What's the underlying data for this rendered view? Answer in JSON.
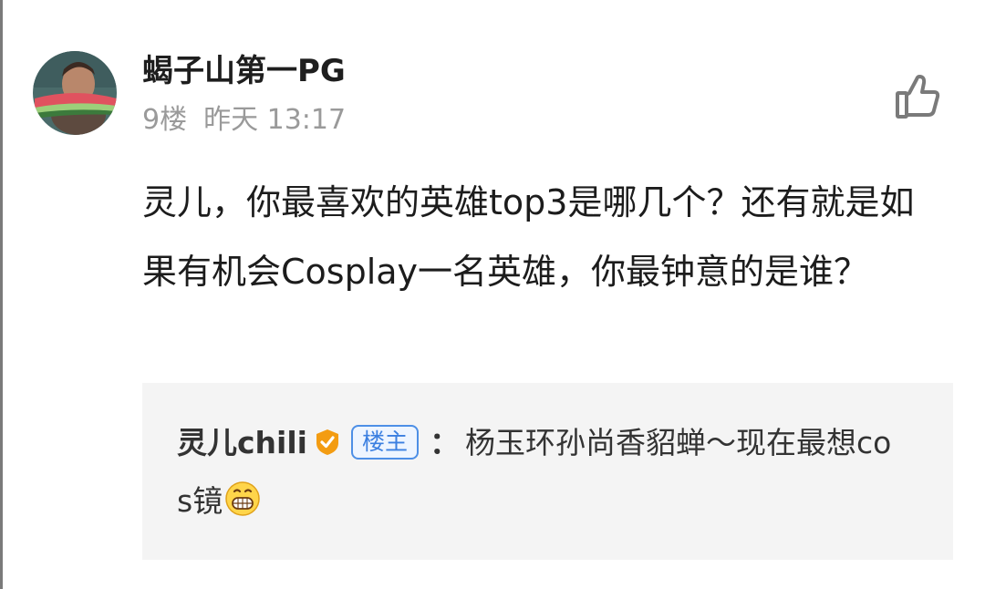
{
  "post": {
    "username": "蝎子山第一PG",
    "floor": "9楼",
    "timestamp": "昨天 13:17",
    "content": "灵儿，你最喜欢的英雄top3是哪几个？还有就是如果有机会Cosplay一名英雄，你最钟意的是谁？",
    "avatar_icon": "avatar-man-eating-watermelon",
    "like_icon": "thumbs-up-icon"
  },
  "reply": {
    "author": "灵儿chili",
    "verified_icon": "verified-badge-icon",
    "badge": "楼主",
    "colon": "：",
    "text": "杨玉环孙尚香貂蝉～现在最想cos镜",
    "emoji": "grinning-face-emoji"
  },
  "colors": {
    "badge_blue": "#4d8fe6",
    "verified_orange": "#f39c12",
    "reply_bg": "#f4f4f4",
    "meta_gray": "#9a9a9a"
  }
}
